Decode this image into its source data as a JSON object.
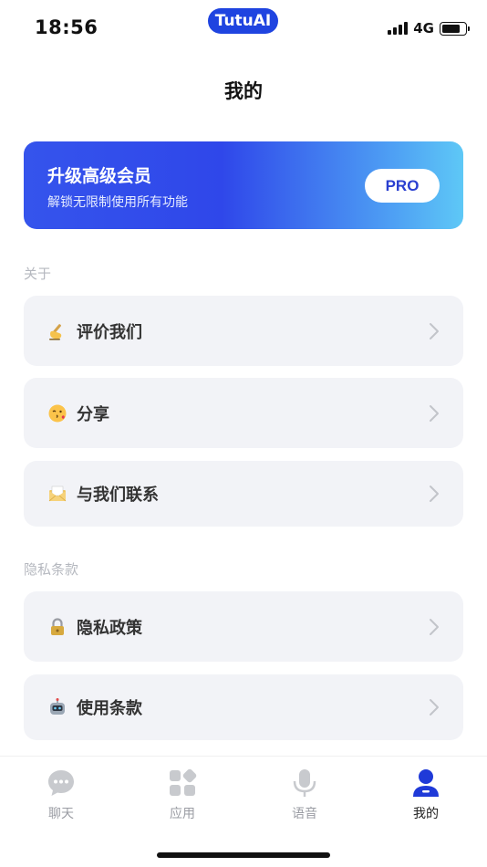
{
  "status_bar": {
    "time": "18:56",
    "app_name": "TutuAI",
    "network": "4G"
  },
  "header": {
    "title": "我的"
  },
  "pro_banner": {
    "title": "升级高级会员",
    "subtitle": "解锁无限制使用所有功能",
    "button_label": "PRO",
    "gradient_start": "#3554ec",
    "gradient_end": "#5ec8f6"
  },
  "sections": [
    {
      "label": "关于",
      "items": [
        {
          "label": "评价我们",
          "icon": "writing-hand-icon"
        },
        {
          "label": "分享",
          "icon": "kissing-face-icon"
        },
        {
          "label": "与我们联系",
          "icon": "envelope-icon"
        }
      ]
    },
    {
      "label": "隐私条款",
      "items": [
        {
          "label": "隐私政策",
          "icon": "lock-icon"
        },
        {
          "label": "使用条款",
          "icon": "robot-icon"
        }
      ]
    }
  ],
  "tab_bar": {
    "tabs": [
      {
        "label": "聊天",
        "icon": "chat-bubble-icon"
      },
      {
        "label": "应用",
        "icon": "apps-grid-icon"
      },
      {
        "label": "语音",
        "icon": "microphone-icon"
      },
      {
        "label": "我的",
        "icon": "profile-icon"
      }
    ],
    "active_index": 3,
    "active_color": "#1f3ad8"
  }
}
